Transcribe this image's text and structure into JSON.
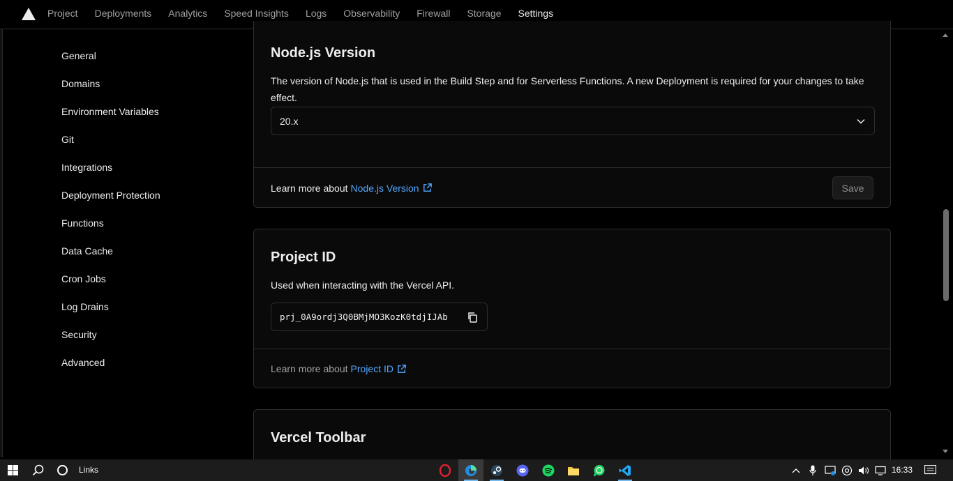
{
  "nav": {
    "tabs": [
      "Project",
      "Deployments",
      "Analytics",
      "Speed Insights",
      "Logs",
      "Observability",
      "Firewall",
      "Storage",
      "Settings"
    ],
    "active": "Settings"
  },
  "sidebar": {
    "items": [
      "General",
      "Domains",
      "Environment Variables",
      "Git",
      "Integrations",
      "Deployment Protection",
      "Functions",
      "Data Cache",
      "Cron Jobs",
      "Log Drains",
      "Security",
      "Advanced"
    ]
  },
  "node_card": {
    "title": "Node.js Version",
    "description": "The version of Node.js that is used in the Build Step and for Serverless Functions. A new Deployment is required for your changes to take effect.",
    "select_value": "20.x",
    "footer_prefix": "Learn more about",
    "footer_link": "Node.js Version",
    "save_label": "Save"
  },
  "project_card": {
    "title": "Project ID",
    "description": "Used when interacting with the Vercel API.",
    "project_id": "prj_0A9ordj3Q0BMjMO3KozK0tdjIJAb",
    "footer_prefix": "Learn more about",
    "footer_link": "Project ID"
  },
  "toolbar_card": {
    "title": "Vercel Toolbar"
  },
  "taskbar": {
    "links_label": "Links",
    "time": "16:33"
  },
  "colors": {
    "link": "#52a8ff",
    "background": "#000000",
    "card_border": "#2e2e2e"
  }
}
